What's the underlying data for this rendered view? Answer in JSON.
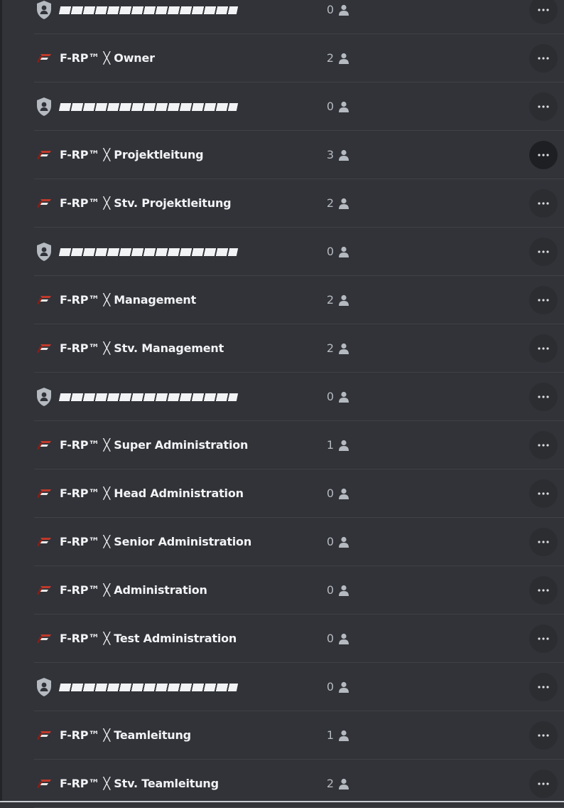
{
  "roles": [
    {
      "type": "separator",
      "name": "",
      "count": "0"
    },
    {
      "type": "role",
      "name": "F-RP™ ╳ Owner",
      "count": "2"
    },
    {
      "type": "separator",
      "name": "",
      "count": "0"
    },
    {
      "type": "role",
      "name": "F-RP™ ╳ Projektleitung",
      "count": "3"
    },
    {
      "type": "role",
      "name": "F-RP™ ╳ Stv. Projektleitung",
      "count": "2"
    },
    {
      "type": "separator",
      "name": "",
      "count": "0"
    },
    {
      "type": "role",
      "name": "F-RP™ ╳ Management",
      "count": "2"
    },
    {
      "type": "role",
      "name": "F-RP™ ╳ Stv. Management",
      "count": "2"
    },
    {
      "type": "separator",
      "name": "",
      "count": "0"
    },
    {
      "type": "role",
      "name": "F-RP™ ╳ Super Administration",
      "count": "1"
    },
    {
      "type": "role",
      "name": "F-RP™ ╳ Head Administration",
      "count": "0"
    },
    {
      "type": "role",
      "name": "F-RP™ ╳ Senior Administration",
      "count": "0"
    },
    {
      "type": "role",
      "name": "F-RP™ ╳ Administration",
      "count": "0"
    },
    {
      "type": "role",
      "name": "F-RP™ ╳ Test Administration",
      "count": "0"
    },
    {
      "type": "separator",
      "name": "",
      "count": "0"
    },
    {
      "type": "role",
      "name": "F-RP™ ╳ Teamleitung",
      "count": "1"
    },
    {
      "type": "role",
      "name": "F-RP™ ╳ Stv. Teamleitung",
      "count": "2"
    }
  ],
  "active_more_index": 3,
  "icons": {
    "role": "frp-logo-icon",
    "separator": "shield-user-icon",
    "member": "person-icon",
    "more": "more-options-icon"
  },
  "colors": {
    "background": "#313338",
    "text": "#f2f3f5",
    "muted": "#b5bac1",
    "logo_red": "#c0392b",
    "shield": "#b5bac1"
  }
}
